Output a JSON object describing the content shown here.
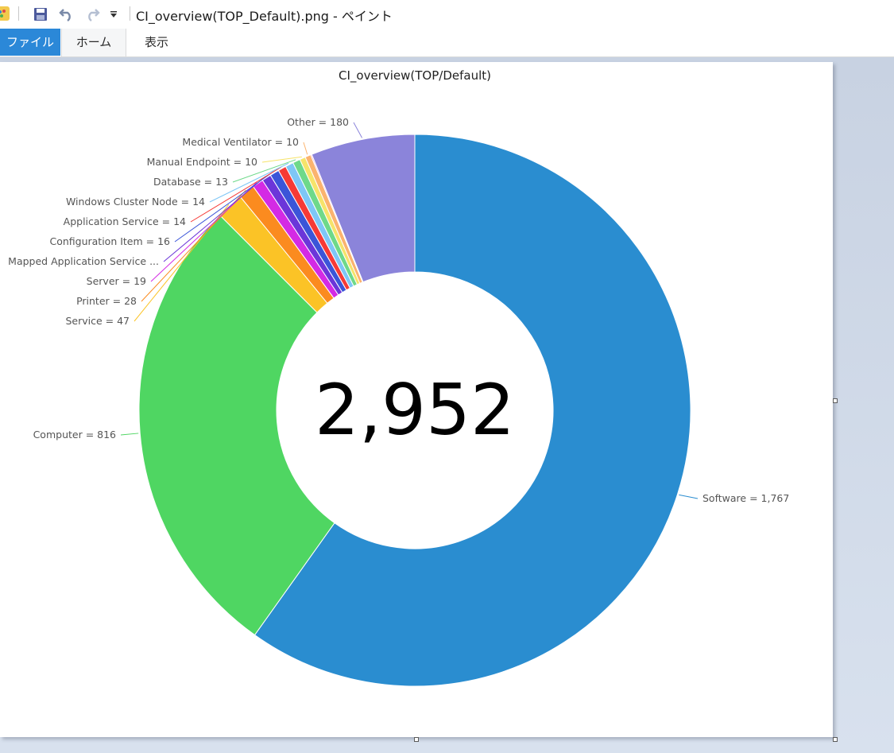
{
  "window": {
    "title": "CI_overview(TOP_Default).png - ペイント"
  },
  "quick_access": {
    "save_icon": "floppy-disk-icon",
    "undo_icon": "undo-arrow-icon",
    "redo_icon": "redo-arrow-icon",
    "customize_icon": "dropdown-arrow-icon"
  },
  "ribbon": {
    "tabs": [
      {
        "label": "ファイル",
        "active": true
      },
      {
        "label": "ホーム"
      },
      {
        "label": "表示"
      }
    ]
  },
  "chart_data": {
    "type": "pie",
    "variant": "donut",
    "title": "CI_overview(TOP/Default)",
    "center_label": "2,952",
    "slices": [
      {
        "name": "Software",
        "value": 1767,
        "label": "Software = 1,767",
        "color": "#2a8dd0"
      },
      {
        "name": "Computer",
        "value": 816,
        "label": "Computer = 816",
        "color": "#4fd662"
      },
      {
        "name": "Service",
        "value": 47,
        "label": "Service = 47",
        "color": "#fbc326"
      },
      {
        "name": "Printer",
        "value": 28,
        "label": "Printer = 28",
        "color": "#fb8b1f"
      },
      {
        "name": "Server",
        "value": 19,
        "label": "Server = 19",
        "color": "#d42ae4"
      },
      {
        "name": "Mapped Application Service",
        "value": 16,
        "label": "Mapped Application Service ...",
        "color": "#6b36d9"
      },
      {
        "name": "Configuration Item",
        "value": 16,
        "label": "Configuration Item = 16",
        "color": "#3b55d8"
      },
      {
        "name": "Application Service",
        "value": 14,
        "label": "Application Service = 14",
        "color": "#f63a36"
      },
      {
        "name": "Windows Cluster Node",
        "value": 14,
        "label": "Windows Cluster Node = 14",
        "color": "#7ec6f6"
      },
      {
        "name": "Database",
        "value": 13,
        "label": "Database = 13",
        "color": "#6ed98a"
      },
      {
        "name": "Manual Endpoint",
        "value": 10,
        "label": "Manual Endpoint = 10",
        "color": "#f6e36a"
      },
      {
        "name": "Medical Ventilator",
        "value": 10,
        "label": "Medical Ventilator = 10",
        "color": "#fbb36e"
      },
      {
        "name": "(unlabeled)",
        "value": 2,
        "label": "",
        "color": "#e68cc8"
      },
      {
        "name": "Other",
        "value": 180,
        "label": "Other = 180",
        "color": "#8b84da"
      }
    ]
  }
}
